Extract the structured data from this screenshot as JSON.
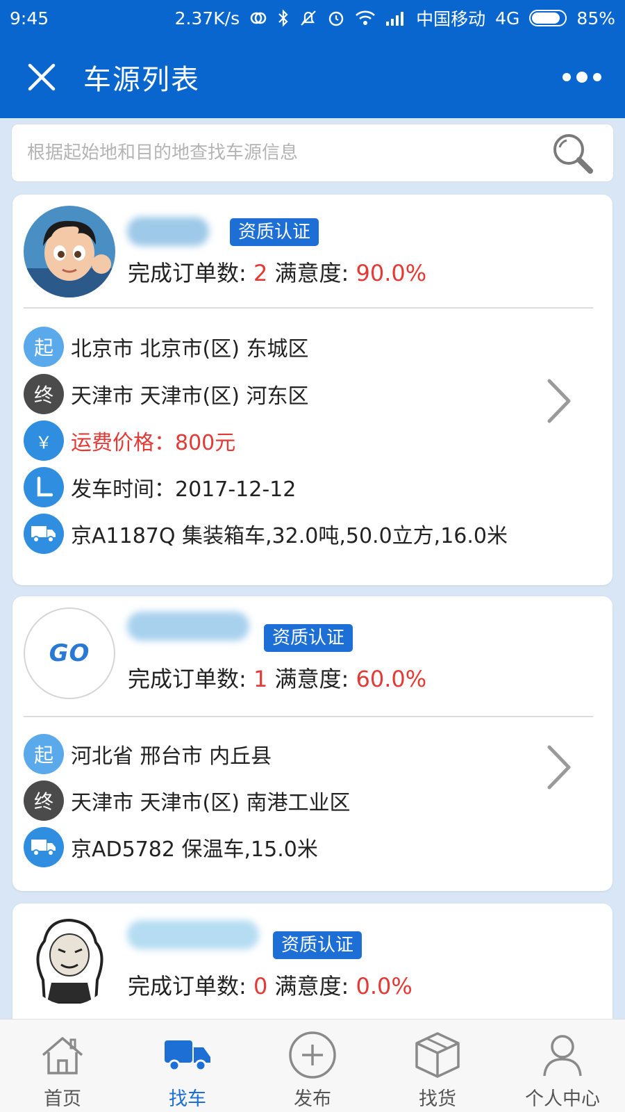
{
  "status_bar": {
    "time": "9:45",
    "speed": "2.37K/s",
    "carrier": "中国移动",
    "network": "4G",
    "battery": "85%",
    "battery_level": 0.85
  },
  "header": {
    "title": "车源列表",
    "close_icon": "close-icon",
    "more_icon": "more-icon"
  },
  "search": {
    "placeholder": "根据起始地和目的地查找车源信息",
    "value": ""
  },
  "labels": {
    "orders_label": "完成订单数: ",
    "satisfaction_label": " 满意度: ",
    "badge": "资质认证",
    "start_icon": "起",
    "end_icon": "终",
    "price_icon": "￥"
  },
  "cards": [
    {
      "orders": "2",
      "satisfaction": "90.0%",
      "start": "北京市 北京市(区) 东城区",
      "end": "天津市 天津市(区) 河东区",
      "price": "运费价格：800元",
      "depart": "发车时间：2017-12-12",
      "vehicle": "京A1187Q 集装箱车,32.0吨,50.0立方,16.0米"
    },
    {
      "logo_text": "GO",
      "orders": "1",
      "satisfaction": "60.0%",
      "start": "河北省 邢台市 内丘县",
      "end": "天津市 天津市(区) 南港工业区",
      "vehicle": "京AD5782 保温车,15.0米"
    },
    {
      "orders": "0",
      "satisfaction": "0.0%"
    }
  ],
  "nav": [
    {
      "label": "首页",
      "icon": "home-icon"
    },
    {
      "label": "找车",
      "icon": "truck-icon",
      "active": true
    },
    {
      "label": "发布",
      "icon": "plus-circle-icon"
    },
    {
      "label": "找货",
      "icon": "box-icon"
    },
    {
      "label": "个人中心",
      "icon": "user-icon"
    }
  ],
  "colors": {
    "primary": "#0a66cf",
    "accent": "#1d6fd6",
    "red": "#e53935"
  }
}
